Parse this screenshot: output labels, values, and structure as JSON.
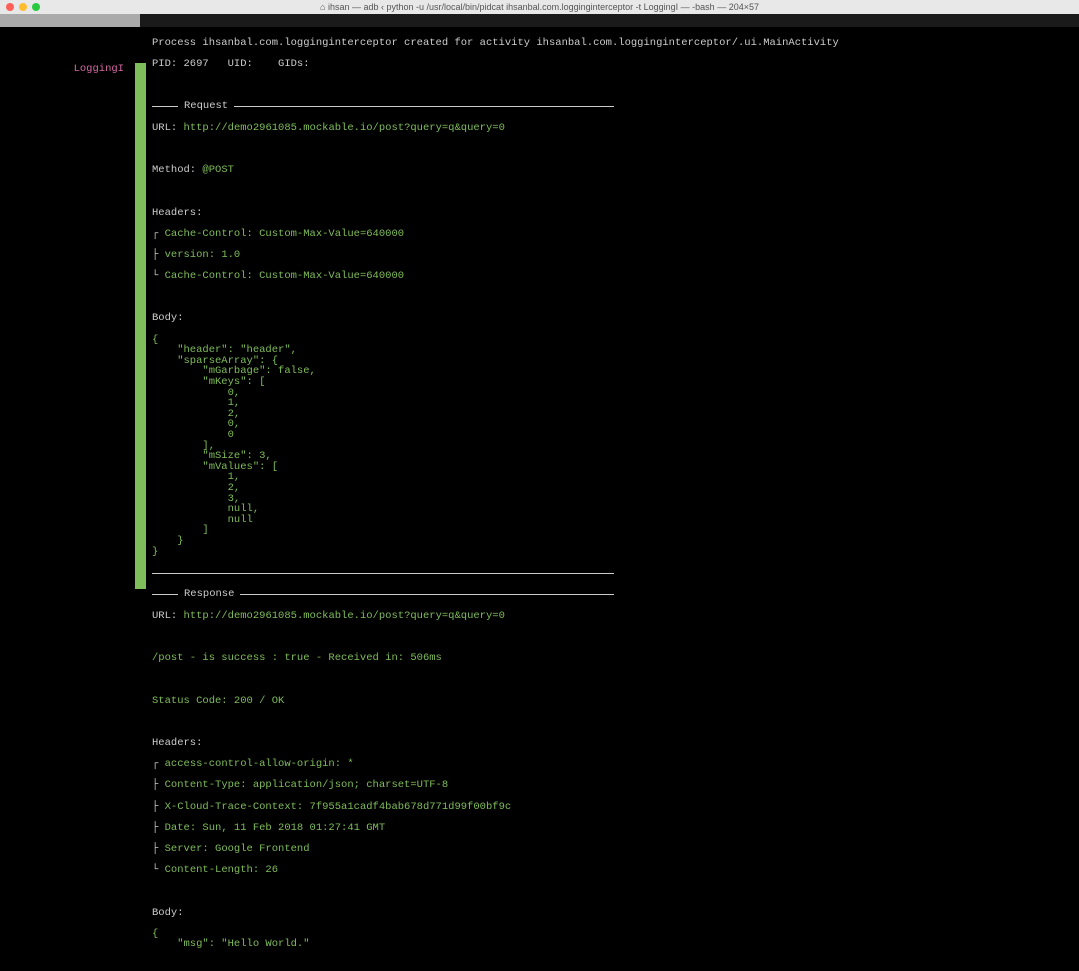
{
  "window": {
    "title": "ihsan — adb ‹ python -u /usr/local/bin/pidcat ihsanbal.com.logginginterceptor -t LoggingI — -bash — 204×57",
    "home_icon": "⌂"
  },
  "process": {
    "line1": "Process ihsanbal.com.logginginterceptor created for activity ihsanbal.com.logginginterceptor/.ui.MainActivity",
    "line2": "PID: 2697   UID:    GIDs:"
  },
  "tag": "LoggingI",
  "request": {
    "label": "Request",
    "url_label": "URL:",
    "url": "http://demo2961085.mockable.io/post?query=q&query=0",
    "method_label": "Method:",
    "method": "@POST",
    "headers_label": "Headers:",
    "headers": [
      "Cache-Control: Custom-Max-Value=640000",
      "version: 1.0",
      "Cache-Control: Custom-Max-Value=640000"
    ],
    "body_label": "Body:",
    "body_text": "{\n    \"header\": \"header\",\n    \"sparseArray\": {\n        \"mGarbage\": false,\n        \"mKeys\": [\n            0,\n            1,\n            2,\n            0,\n            0\n        ],\n        \"mSize\": 3,\n        \"mValues\": [\n            1,\n            2,\n            3,\n            null,\n            null\n        ]\n    }\n}"
  },
  "response": {
    "label": "Response",
    "url_label": "URL:",
    "url": "http://demo2961085.mockable.io/post?query=q&query=0",
    "status_line": "/post - is success : true - Received in: 506ms",
    "status_code_line": "Status Code: 200 / OK",
    "headers_label": "Headers:",
    "headers": [
      "access-control-allow-origin: *",
      "Content-Type: application/json; charset=UTF-8",
      "X-Cloud-Trace-Context: 7f955a1cadf4bab678d771d99f00bf9c",
      "Date: Sun, 11 Feb 2018 01:27:41 GMT",
      "Server: Google Frontend",
      "Content-Length: 26"
    ],
    "body_label": "Body:",
    "body_text": "{\n    \"msg\": \"Hello World.\""
  }
}
